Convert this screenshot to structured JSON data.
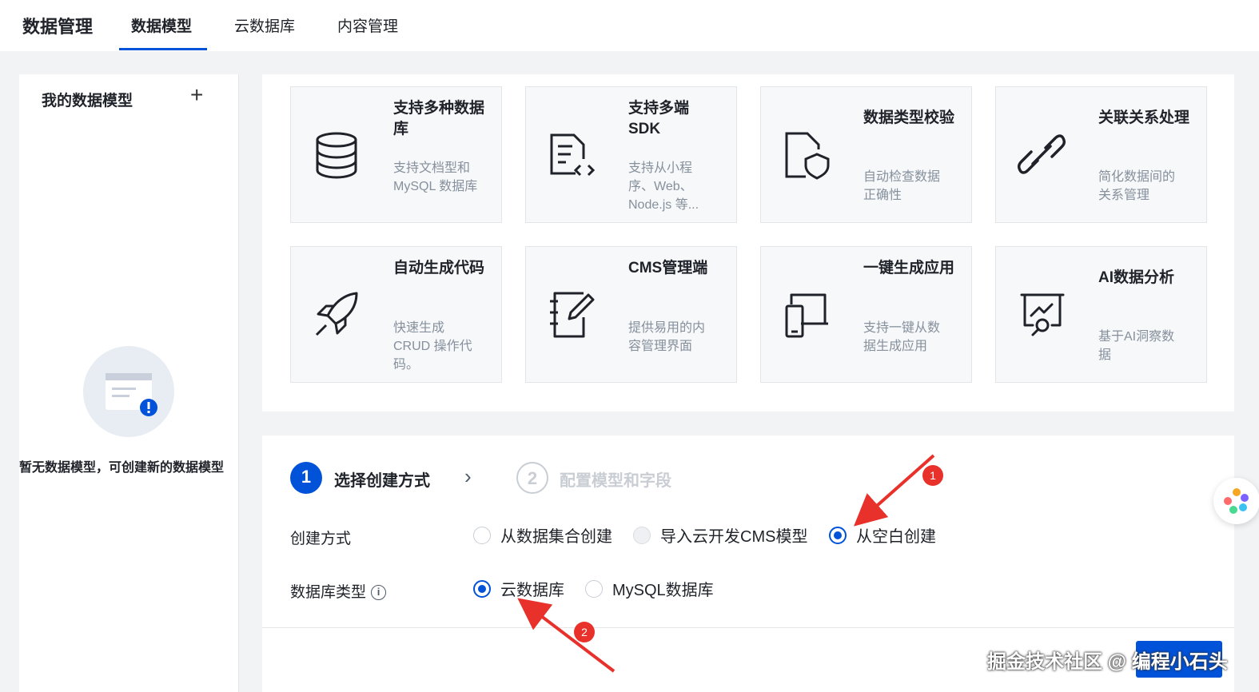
{
  "header": {
    "app_title": "数据管理",
    "tabs": [
      {
        "label": "数据模型",
        "active": true
      },
      {
        "label": "云数据库",
        "active": false
      },
      {
        "label": "内容管理",
        "active": false
      }
    ]
  },
  "sidebar": {
    "title": "我的数据模型",
    "add_icon": "plus-icon",
    "empty_text": "暂无数据模型，可创建新的数据模型"
  },
  "features": [
    {
      "icon": "database-icon",
      "title": "支持多种数据库",
      "desc": "支持文档型和 MySQL 数据库"
    },
    {
      "icon": "code-file-icon",
      "title": "支持多端 SDK",
      "desc": "支持从小程序、Web、Node.js 等..."
    },
    {
      "icon": "shield-file-icon",
      "title": "数据类型校验",
      "desc": "自动检查数据正确性"
    },
    {
      "icon": "link-icon",
      "title": "关联关系处理",
      "desc": "简化数据间的关系管理"
    },
    {
      "icon": "rocket-icon",
      "title": "自动生成代码",
      "desc": "快速生成 CRUD 操作代码。"
    },
    {
      "icon": "notebook-edit-icon",
      "title": "CMS管理端",
      "desc": "提供易用的内容管理界面"
    },
    {
      "icon": "devices-icon",
      "title": "一键生成应用",
      "desc": "支持一键从数据生成应用"
    },
    {
      "icon": "analytics-icon",
      "title": "AI数据分析",
      "desc": "基于AI洞察数据"
    }
  ],
  "wizard": {
    "step1": {
      "num": "1",
      "label": "选择创建方式"
    },
    "step2": {
      "num": "2",
      "label": "配置模型和字段"
    },
    "create_method": {
      "label": "创建方式",
      "options": [
        {
          "label": "从数据集合创建",
          "checked": false
        },
        {
          "label": "导入云开发CMS模型",
          "checked": false
        },
        {
          "label": "从空白创建",
          "checked": true
        }
      ]
    },
    "db_type": {
      "label": "数据库类型",
      "options": [
        {
          "label": "云数据库",
          "checked": true
        },
        {
          "label": "MySQL数据库",
          "checked": false
        }
      ]
    }
  },
  "annotations": {
    "badge1": "1",
    "badge2": "2"
  },
  "watermark": "掘金技术社区 @ 编程小石头",
  "colors": {
    "primary": "#0052d9",
    "annotation": "#e8312a"
  }
}
